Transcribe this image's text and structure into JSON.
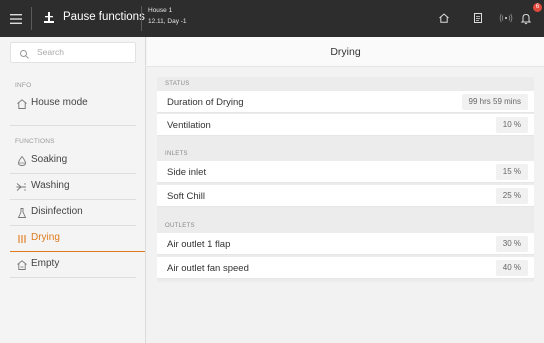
{
  "topbar": {
    "title": "Pause functions",
    "house": "House 1",
    "date": "12.11, Day -1",
    "notification_count": "6",
    "icons": [
      "menu-icon",
      "pause-functions-icon",
      "home-icon",
      "document-icon",
      "signal-icon",
      "bell-icon"
    ]
  },
  "sidebar": {
    "search_placeholder": "Search",
    "info_header": "INFO",
    "functions_header": "FUNCTIONS",
    "items": [
      {
        "label": "House mode",
        "icon": "house-icon"
      },
      {
        "label": "Soaking",
        "icon": "droplet-icon"
      },
      {
        "label": "Washing",
        "icon": "spray-icon"
      },
      {
        "label": "Disinfection",
        "icon": "flask-icon"
      },
      {
        "label": "Drying",
        "icon": "heat-icon",
        "active": true
      },
      {
        "label": "Empty",
        "icon": "empty-house-icon"
      }
    ],
    "accent": "#e07a1c"
  },
  "main": {
    "title": "Drying",
    "status_header": "STATUS",
    "inlets_header": "INLETS",
    "outlets_header": "OUTLETS",
    "status": [
      {
        "label": "Duration of Drying",
        "value": "99 hrs 59 mins"
      },
      {
        "label": "Ventilation",
        "value": "10 %"
      }
    ],
    "inlets": [
      {
        "label": "Side inlet",
        "value": "15 %"
      },
      {
        "label": "Soft Chill",
        "value": "25 %"
      }
    ],
    "outlets": [
      {
        "label": "Air outlet 1 flap",
        "value": "30 %"
      },
      {
        "label": "Air outlet fan speed",
        "value": "40 %"
      }
    ]
  }
}
